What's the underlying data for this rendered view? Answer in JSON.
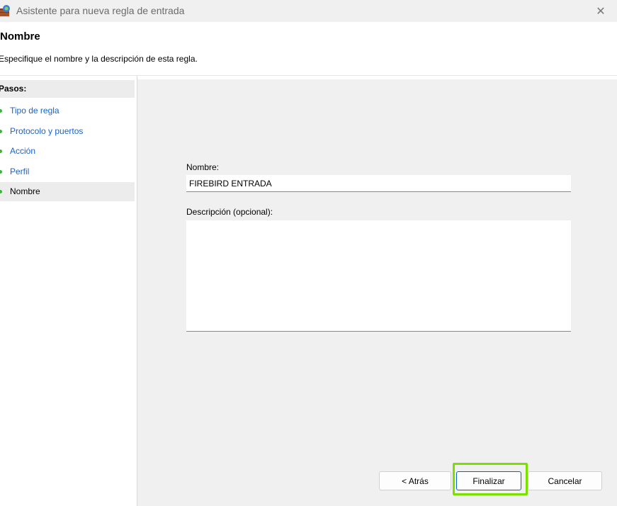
{
  "window": {
    "title": "Asistente para nueva regla de entrada",
    "close_glyph": "✕",
    "icon": "firewall-wizard-icon"
  },
  "header": {
    "title": "Nombre",
    "subtitle": "Especifique el nombre y la descripción de esta regla."
  },
  "sidebar": {
    "heading": "Pasos:",
    "steps": [
      {
        "label": "Tipo de regla",
        "state": "link"
      },
      {
        "label": "Protocolo y puertos",
        "state": "link"
      },
      {
        "label": "Acción",
        "state": "link"
      },
      {
        "label": "Perfil",
        "state": "link"
      },
      {
        "label": "Nombre",
        "state": "current"
      }
    ]
  },
  "form": {
    "name_label": "Nombre:",
    "name_value": "FIREBIRD ENTRADA",
    "description_label": "Descripción (opcional):",
    "description_value": ""
  },
  "buttons": {
    "back": "< Atrás",
    "finish": "Finalizar",
    "cancel": "Cancelar"
  },
  "colors": {
    "link": "#1a63c8",
    "step_dot": "#3cb43c",
    "highlight": "#7be000",
    "panel_bg": "#f0f0f0"
  }
}
